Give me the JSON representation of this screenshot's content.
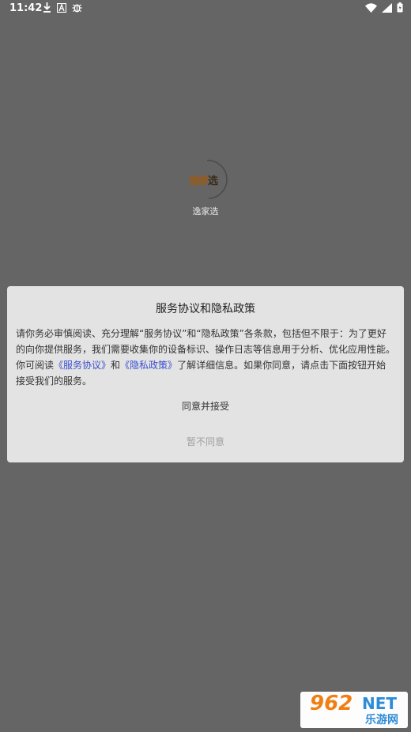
{
  "status_bar": {
    "time": "11:42"
  },
  "splash": {
    "logo_text_a": "逸家",
    "logo_text_b": "选",
    "app_name": "逸家选"
  },
  "dialog": {
    "title": "服务协议和隐私政策",
    "body_part1": "请你务必审慎阅读、充分理解“服务协议”和“隐私政策”各条款，包括但不限于：为了更好的向你提供服务，我们需要收集你的设备标识、操作日志等信息用于分析、优化应用性能。你可阅读",
    "link_service": "《服务协议》",
    "body_and": "和",
    "link_privacy": "《隐私政策》",
    "body_part2": "了解详细信息。如果你同意，请点击下面按钮开始接受我们的服务。",
    "accept_label": "同意并接受",
    "decline_label": "暂不同意"
  },
  "watermark": {
    "num": "962",
    "net": "NET",
    "cn": "乐游网"
  }
}
